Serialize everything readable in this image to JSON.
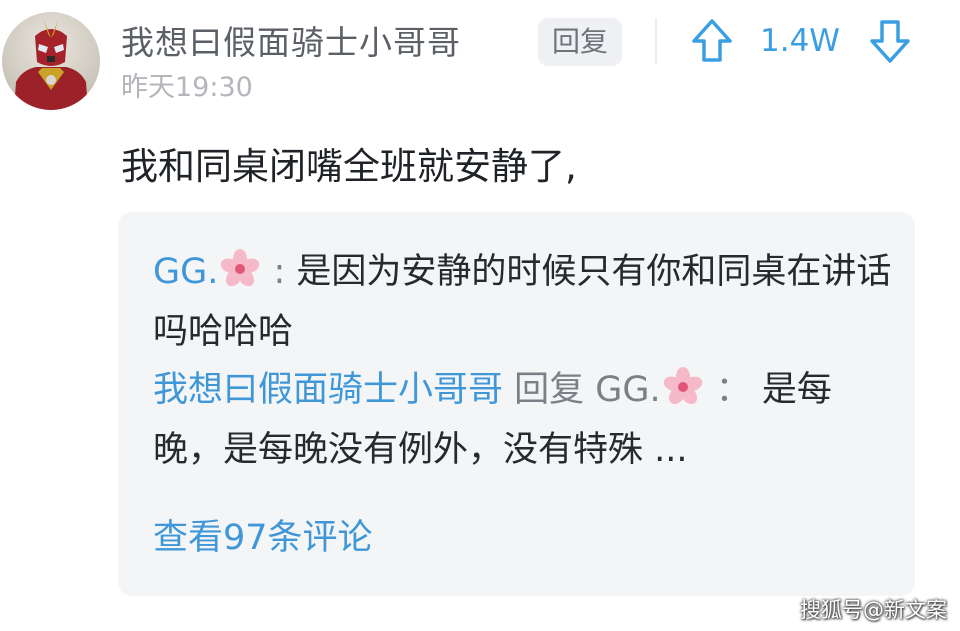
{
  "comment": {
    "username": "我想曰假面骑士小哥哥",
    "timestamp": "昨天19:30",
    "reply_label": "回复",
    "vote_count": "1.4W",
    "text": "我和同桌闭嘴全班就安静了,"
  },
  "replies": [
    {
      "author": "GG.",
      "author_emoji": "cherry-blossom-icon",
      "separator": " : ",
      "text": "是因为安静的时候只有你和同桌在讲话吗哈哈哈"
    },
    {
      "author": "我想曰假面骑士小哥哥",
      "reply_word": " 回复 ",
      "target": "GG.",
      "target_emoji": "cherry-blossom-icon",
      "separator": " ： ",
      "text": "是每晚，是每晚没有例外，没有特殊 ..."
    }
  ],
  "view_more": "查看97条评论",
  "watermark": "搜狐号@新文案",
  "colors": {
    "link_blue": "#3f97d8",
    "vote_blue": "#3a9fe2",
    "box_bg": "#f4f5f7"
  }
}
